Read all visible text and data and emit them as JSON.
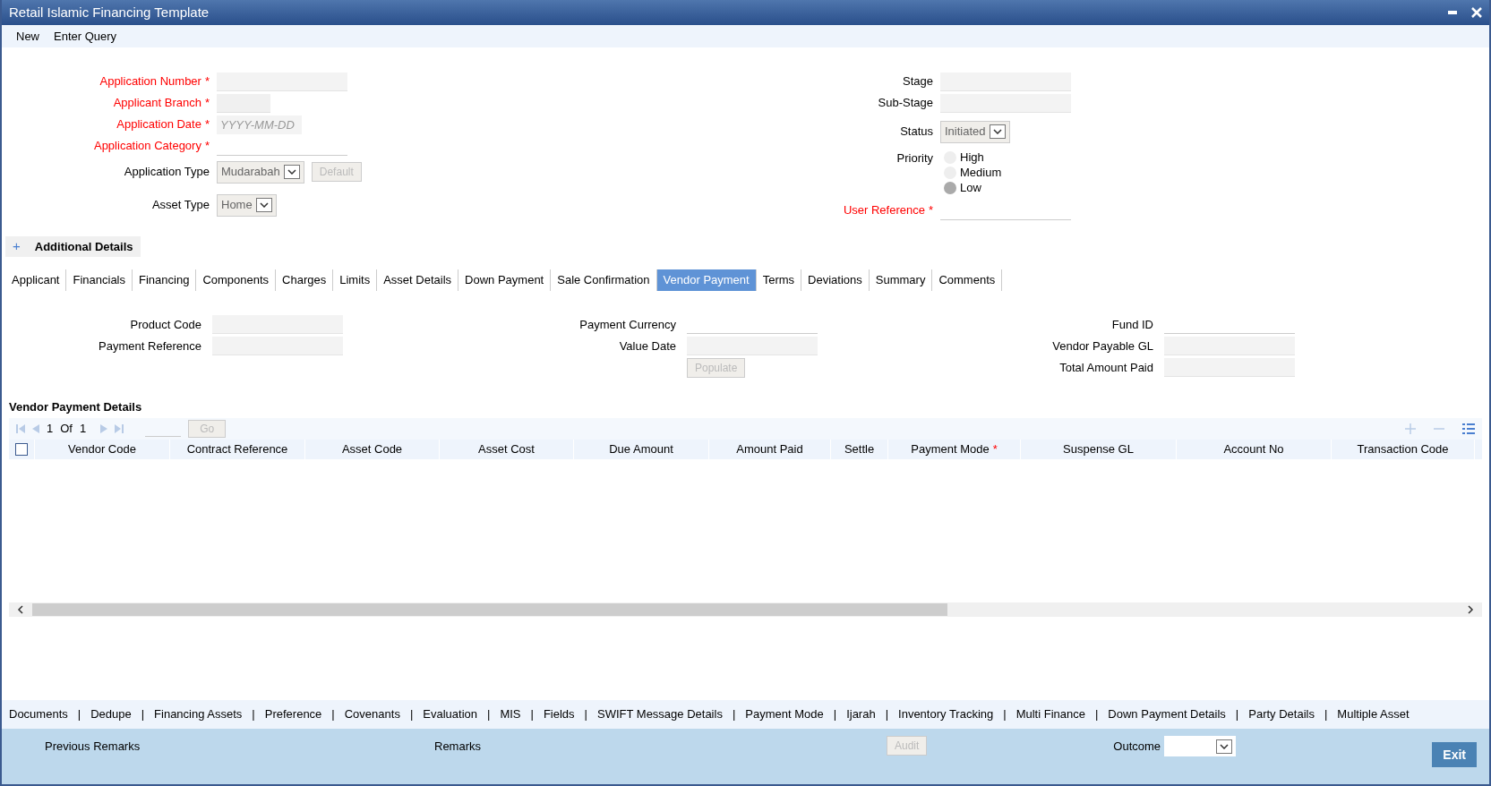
{
  "window": {
    "title": "Retail Islamic Financing Template"
  },
  "menu": [
    "New",
    "Enter Query"
  ],
  "header_left": [
    {
      "label": "Application Number",
      "required_mark": "*",
      "kind": "text"
    },
    {
      "label": "Applicant Branch",
      "required_mark": "*",
      "kind": "short"
    },
    {
      "label": "Application Date",
      "required_mark": "*",
      "kind": "date",
      "placeholder": "YYYY-MM-DD"
    },
    {
      "label": "Application Category",
      "required_mark": "*",
      "kind": "line"
    },
    {
      "label": "Application Type",
      "kind": "select",
      "value": "Mudarabah",
      "button": "Default"
    },
    {
      "label": "Asset Type",
      "kind": "select",
      "value": "Home"
    }
  ],
  "header_right": [
    {
      "label": "Stage",
      "kind": "text"
    },
    {
      "label": "Sub-Stage",
      "kind": "text"
    },
    {
      "label": "Status",
      "kind": "select",
      "value": "Initiated"
    },
    {
      "label": "Priority",
      "kind": "radio",
      "options": [
        {
          "label": "High",
          "selected": false
        },
        {
          "label": "Medium",
          "selected": false
        },
        {
          "label": "Low",
          "selected": true
        }
      ]
    },
    {
      "label": "User Reference",
      "required_mark": "*",
      "kind": "line"
    }
  ],
  "additional_details": {
    "icon": "+",
    "label": "Additional Details"
  },
  "tabs": [
    {
      "label": "Applicant",
      "selected": false
    },
    {
      "label": "Financials",
      "selected": false
    },
    {
      "label": "Financing",
      "selected": false
    },
    {
      "label": "Components",
      "selected": false
    },
    {
      "label": "Charges",
      "selected": false
    },
    {
      "label": "Limits",
      "selected": false
    },
    {
      "label": "Asset Details",
      "selected": false
    },
    {
      "label": "Down Payment",
      "selected": false
    },
    {
      "label": "Sale Confirmation",
      "selected": false
    },
    {
      "label": "Vendor Payment",
      "selected": true
    },
    {
      "label": "Terms",
      "selected": false
    },
    {
      "label": "Deviations",
      "selected": false
    },
    {
      "label": "Summary",
      "selected": false
    },
    {
      "label": "Comments",
      "selected": false
    }
  ],
  "vendor_fields": [
    [
      {
        "label": "Product Code",
        "kind": "text"
      },
      {
        "label": "Payment Reference",
        "kind": "text"
      }
    ],
    [
      {
        "label": "Payment Currency",
        "kind": "line"
      },
      {
        "label": "Value Date",
        "kind": "text"
      },
      {
        "label": "Populate",
        "kind": "button"
      }
    ],
    [
      {
        "label": "Fund ID",
        "kind": "line"
      },
      {
        "label": "Vendor Payable GL",
        "kind": "text"
      },
      {
        "label": "Total Amount Paid",
        "kind": "text"
      }
    ]
  ],
  "grid": {
    "title": "Vendor Payment Details",
    "pager": {
      "page": "1",
      "of": "Of",
      "total": "1",
      "go": "Go"
    },
    "select_all": {
      "checked": false
    },
    "columns": [
      {
        "label": "Vendor Code"
      },
      {
        "label": "Contract Reference"
      },
      {
        "label": "Asset Code"
      },
      {
        "label": "Asset Cost"
      },
      {
        "label": "Due Amount"
      },
      {
        "label": "Amount Paid"
      },
      {
        "label": "Settle"
      },
      {
        "label": "Payment Mode",
        "required_mark": "*"
      },
      {
        "label": "Suspense GL"
      },
      {
        "label": "Account No"
      },
      {
        "label": "Transaction Code"
      }
    ]
  },
  "bottom_links": [
    {
      "label": "Documents"
    },
    {
      "separator": "|",
      "label": "Dedupe"
    },
    {
      "separator": "|",
      "label": "Financing Assets"
    },
    {
      "separator": "|",
      "label": "Preference"
    },
    {
      "separator": "|",
      "label": "Covenants"
    },
    {
      "separator": "|",
      "label": "Evaluation"
    },
    {
      "separator": "|",
      "label": "MIS"
    },
    {
      "separator": "|",
      "label": "Fields"
    },
    {
      "separator": "|",
      "label": "SWIFT Message Details"
    },
    {
      "separator": "|",
      "label": "Payment Mode"
    },
    {
      "separator": "|",
      "label": "Ijarah"
    },
    {
      "separator": "|",
      "label": "Inventory Tracking"
    },
    {
      "separator": "|",
      "label": "Multi Finance"
    },
    {
      "separator": "|",
      "label": "Down Payment Details"
    },
    {
      "separator": "|",
      "label": "Party Details"
    },
    {
      "separator": "|",
      "label": "Multiple Asset"
    }
  ],
  "footer": {
    "previous_remarks": "Previous Remarks",
    "remarks": "Remarks",
    "audit": "Audit",
    "outcome": "Outcome",
    "exit": "Exit"
  }
}
